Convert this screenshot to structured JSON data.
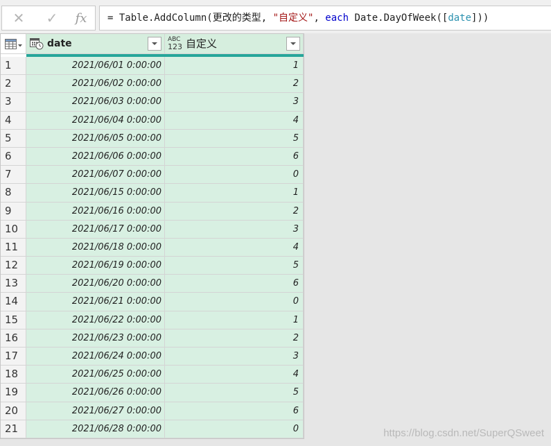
{
  "formula": {
    "prefix": "= Table.AddColumn(",
    "step_ref": "更改的类型",
    "sep1": ", ",
    "new_col": "\"自定义\"",
    "sep2": ", ",
    "keyword": "each",
    "expr_start": " Date.DayOfWeek([",
    "field": "date",
    "expr_end": "]))"
  },
  "formula_buttons": {
    "cancel": "✕",
    "commit": "✓",
    "fx": "fx"
  },
  "columns": {
    "date": {
      "label": "date",
      "type_icon": "datetime-type-icon"
    },
    "custom": {
      "label": "自定义",
      "type_icon": "any-type-icon",
      "type_top": "ABC",
      "type_bottom": "123"
    }
  },
  "rows": [
    {
      "n": "1",
      "date": "2021/06/01 0:00:00",
      "value": "1"
    },
    {
      "n": "2",
      "date": "2021/06/02 0:00:00",
      "value": "2"
    },
    {
      "n": "3",
      "date": "2021/06/03 0:00:00",
      "value": "3"
    },
    {
      "n": "4",
      "date": "2021/06/04 0:00:00",
      "value": "4"
    },
    {
      "n": "5",
      "date": "2021/06/05 0:00:00",
      "value": "5"
    },
    {
      "n": "6",
      "date": "2021/06/06 0:00:00",
      "value": "6"
    },
    {
      "n": "7",
      "date": "2021/06/07 0:00:00",
      "value": "0"
    },
    {
      "n": "8",
      "date": "2021/06/15 0:00:00",
      "value": "1"
    },
    {
      "n": "9",
      "date": "2021/06/16 0:00:00",
      "value": "2"
    },
    {
      "n": "10",
      "date": "2021/06/17 0:00:00",
      "value": "3"
    },
    {
      "n": "11",
      "date": "2021/06/18 0:00:00",
      "value": "4"
    },
    {
      "n": "12",
      "date": "2021/06/19 0:00:00",
      "value": "5"
    },
    {
      "n": "13",
      "date": "2021/06/20 0:00:00",
      "value": "6"
    },
    {
      "n": "14",
      "date": "2021/06/21 0:00:00",
      "value": "0"
    },
    {
      "n": "15",
      "date": "2021/06/22 0:00:00",
      "value": "1"
    },
    {
      "n": "16",
      "date": "2021/06/23 0:00:00",
      "value": "2"
    },
    {
      "n": "17",
      "date": "2021/06/24 0:00:00",
      "value": "3"
    },
    {
      "n": "18",
      "date": "2021/06/25 0:00:00",
      "value": "4"
    },
    {
      "n": "19",
      "date": "2021/06/26 0:00:00",
      "value": "5"
    },
    {
      "n": "20",
      "date": "2021/06/27 0:00:00",
      "value": "6"
    },
    {
      "n": "21",
      "date": "2021/06/28 0:00:00",
      "value": "0"
    }
  ],
  "watermark": "https://blog.csdn.net/SuperQSweet",
  "colors": {
    "header_accent": "#26a69a",
    "column_fill": "#d8f0e2",
    "string_token": "#a31515",
    "keyword_token": "#0000cc",
    "ref_token": "#2b91af"
  }
}
